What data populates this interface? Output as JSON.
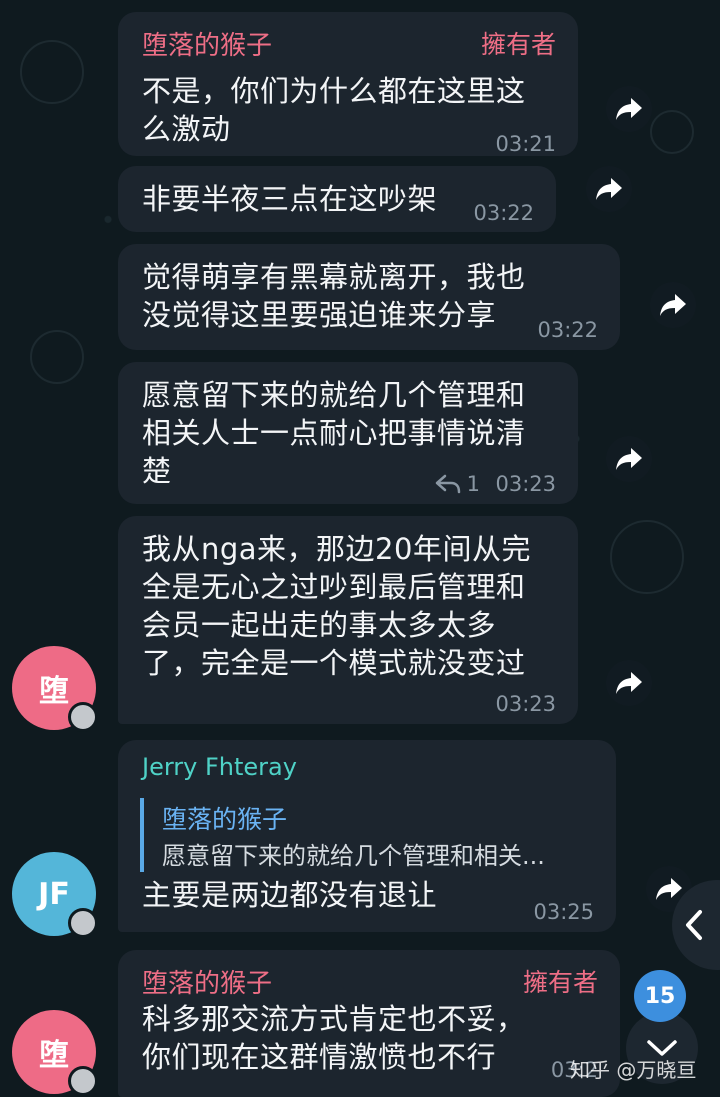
{
  "messages": [
    {
      "sender": "堕落的猴子",
      "role": "擁有者",
      "lines": [
        "不是，你们为什么都在这里这",
        "么激动"
      ],
      "time": "03:21"
    },
    {
      "lines": [
        "非要半夜三点在这吵架"
      ],
      "time": "03:22"
    },
    {
      "lines": [
        "觉得萌享有黑幕就离开，我也",
        "没觉得这里要强迫谁来分享"
      ],
      "time": "03:22"
    },
    {
      "lines": [
        "愿意留下来的就给几个管理和",
        "相关人士一点耐心把事情说清",
        "楚"
      ],
      "replies": "1",
      "time": "03:23"
    },
    {
      "lines": [
        "我从nga来，那边20年间从完",
        "全是无心之过吵到最后管理和",
        "会员一起出走的事太多太多",
        "了，完全是一个模式就没变过"
      ],
      "time": "03:23"
    },
    {
      "sender": "Jerry Fhteray",
      "quote_name": "堕落的猴子",
      "quote_text": "愿意留下来的就给几个管理和相关...",
      "lines": [
        "主要是两边都没有退让"
      ],
      "time": "03:25"
    },
    {
      "sender": "堕落的猴子",
      "role": "擁有者",
      "lines": [
        "科多那交流方式肯定也不妥，",
        "你们现在这群情激愤也不行"
      ],
      "time": "03:2"
    }
  ],
  "avatars": {
    "monkey": "堕",
    "jerry": "JF"
  },
  "unread_count": "15",
  "watermark": "知乎 @万晓亘",
  "colors": {
    "bubble": "#1c252e",
    "owner_name": "#ee6e86",
    "jerry_name": "#4fd2c7",
    "quote_bar": "#5aa9e6",
    "badge": "#3d8fde"
  },
  "icons": {
    "forward": "forward-arrow-icon",
    "reply": "reply-arrow-icon",
    "scroll": "chevron-down-icon",
    "side": "chevron-left-icon"
  }
}
